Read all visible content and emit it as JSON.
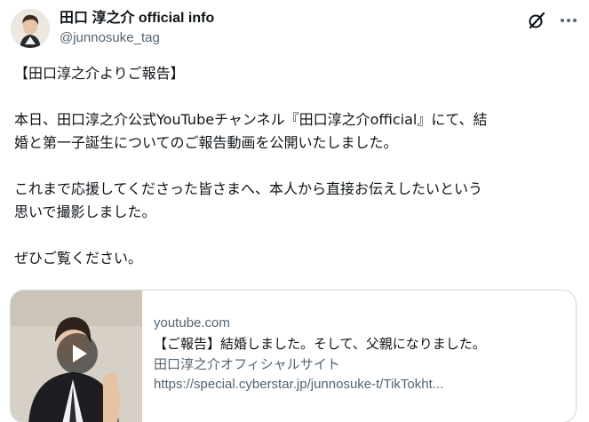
{
  "author": {
    "display_name": "田口 淳之介 official info",
    "handle": "@junnosuke_tag"
  },
  "icons": {
    "grok": "grok-icon",
    "more": "more-icon",
    "play": "play-icon"
  },
  "post": {
    "paragraphs": [
      [
        "【田口淳之介よりご報告】"
      ],
      [
        "本日、田口淳之介公式YouTubeチャンネル『田口淳之介official』にて、結",
        "婚と第一子誕生についてのご報告動画を公開いたしました。"
      ],
      [
        "これまで応援してくださった皆さまへ、本人から直接お伝えしたいという",
        "思いで撮影しました。"
      ],
      [
        "ぜひご覧ください。"
      ]
    ]
  },
  "link_card": {
    "domain": "youtube.com",
    "title": "【ご報告】結婚しました。そして、父親になりました。",
    "description": "田口淳之介オフィシャルサイト",
    "url": "https://special.cyberstar.jp/junnosuke-t/TikTokht..."
  },
  "colors": {
    "text_primary": "#0f1419",
    "text_secondary": "#536471",
    "border": "#cfd9de"
  }
}
